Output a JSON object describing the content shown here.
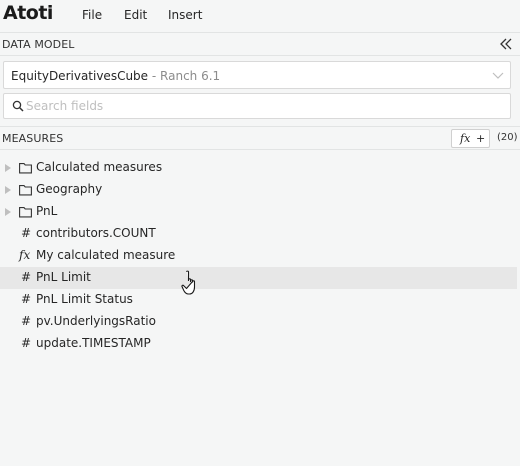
{
  "app": {
    "logo": "Atoti",
    "menu": [
      {
        "label": "File"
      },
      {
        "label": "Edit"
      },
      {
        "label": "Insert"
      }
    ]
  },
  "data_model": {
    "title": "DATA MODEL",
    "cube": {
      "name": "EquityDerivativesCube",
      "separator": " - ",
      "server": "Ranch 6.1"
    },
    "search": {
      "placeholder": "Search fields",
      "value": ""
    }
  },
  "measures": {
    "title": "MEASURES",
    "fx_button": {
      "fx": "fx",
      "plus": "+"
    },
    "count": "(20)",
    "items": [
      {
        "label": "Calculated measures",
        "type": "folder",
        "icon": "folder-icon"
      },
      {
        "label": "Geography",
        "type": "folder",
        "icon": "folder-icon"
      },
      {
        "label": "PnL",
        "type": "folder",
        "icon": "folder-icon"
      },
      {
        "label": "contributors.COUNT",
        "type": "measure",
        "icon": "#"
      },
      {
        "label": "My calculated measure",
        "type": "calculated",
        "icon": "fx"
      },
      {
        "label": "PnL Limit",
        "type": "measure",
        "icon": "#"
      },
      {
        "label": "PnL Limit Status",
        "type": "measure",
        "icon": "#"
      },
      {
        "label": "pv.UnderlyingsRatio",
        "type": "measure",
        "icon": "#"
      },
      {
        "label": "update.TIMESTAMP",
        "type": "measure",
        "icon": "#"
      }
    ]
  }
}
